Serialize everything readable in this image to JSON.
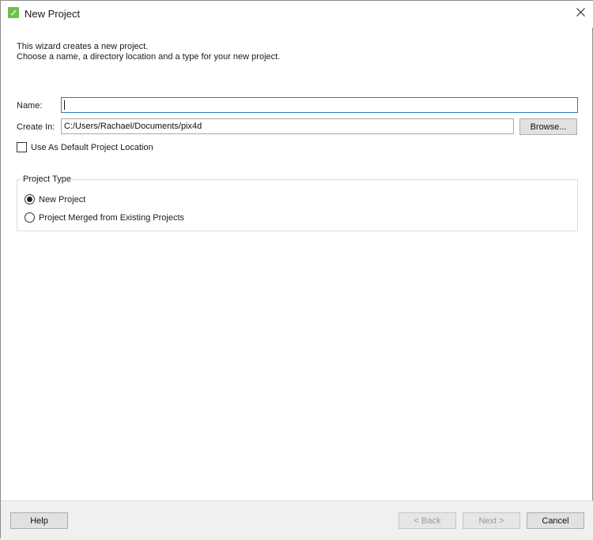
{
  "window": {
    "title": "New Project",
    "close_glyph": "✕"
  },
  "icons": {
    "app": "pix4d-app-icon",
    "close": "close-icon"
  },
  "intro": {
    "line1": "This wizard creates a new project.",
    "line2": "Choose a name, a directory location and a type for your new project."
  },
  "form": {
    "name_label": "Name:",
    "name_value": "",
    "create_in_label": "Create In:",
    "create_in_value": "C:/Users/Rachael/Documents/pix4d",
    "browse_label": "Browse...",
    "default_location_label": "Use As Default Project Location",
    "default_location_checked": false
  },
  "project_type": {
    "title": "Project Type",
    "options": [
      {
        "label": "New Project",
        "checked": true
      },
      {
        "label": "Project Merged from Existing Projects",
        "checked": false
      }
    ]
  },
  "footer": {
    "help": "Help",
    "back": "< Back",
    "next": "Next >",
    "cancel": "Cancel"
  },
  "colors": {
    "accent": "#2d7bbd",
    "app_icon": "#6cc04a"
  }
}
